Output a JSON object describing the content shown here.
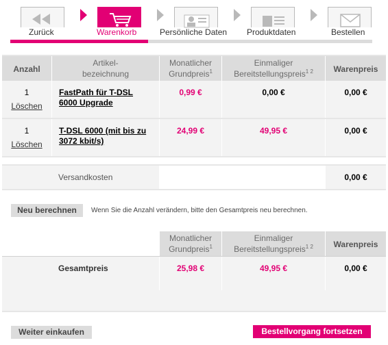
{
  "steps": [
    {
      "label": "Zurück",
      "icon": "back-arrow-icon"
    },
    {
      "label": "Warenkorb",
      "icon": "cart-icon"
    },
    {
      "label": "Persönliche Daten",
      "icon": "id-card-icon"
    },
    {
      "label": "Produktdaten",
      "icon": "document-icon"
    },
    {
      "label": "Bestellen",
      "icon": "envelope-icon"
    }
  ],
  "progress_fraction": 0.38,
  "table": {
    "headers": {
      "qty_line1": "Anzahl",
      "article_line1": "Artikel-",
      "article_line2": "bezeichnung",
      "monthly_line1": "Monatlicher",
      "monthly_line2": "Grundpreis",
      "monthly_sup": "1",
      "setup_line1": "Einmaliger",
      "setup_line2": "Bereitstellungspreis",
      "setup_sup": "1 2",
      "item_price": "Warenpreis"
    },
    "items": [
      {
        "qty": "1",
        "delete": "Löschen",
        "name_line1": "FastPath für T-DSL",
        "name_line2": "6000 Upgrade",
        "monthly": "0,99 €",
        "setup": "0,00 €",
        "item_price": "0,00 €"
      },
      {
        "qty": "1",
        "delete": "Löschen",
        "name_line1": "T-DSL 6000 (mit bis zu",
        "name_line2": "3072 kbit/s)",
        "monthly": "24,99 €",
        "setup": "49,95 €",
        "item_price": "0,00 €"
      }
    ],
    "shipping_label": "Versandkosten",
    "shipping_value": "0,00 €"
  },
  "recalc": {
    "button": "Neu berechnen",
    "hint": "Wenn Sie die Anzahl verändern, bitte den Gesamtpreis neu berechnen."
  },
  "totals": {
    "label": "Gesamtpreis",
    "monthly": "25,98 €",
    "setup": "49,95 €",
    "item_price": "0,00 €"
  },
  "footer": {
    "continue_shopping": "Weiter einkaufen",
    "proceed": "Bestellvorgang fortsetzen"
  },
  "colors": {
    "accent": "#e20074",
    "header_bg": "#dcdcdc",
    "row_bg": "#f3f3f3"
  }
}
